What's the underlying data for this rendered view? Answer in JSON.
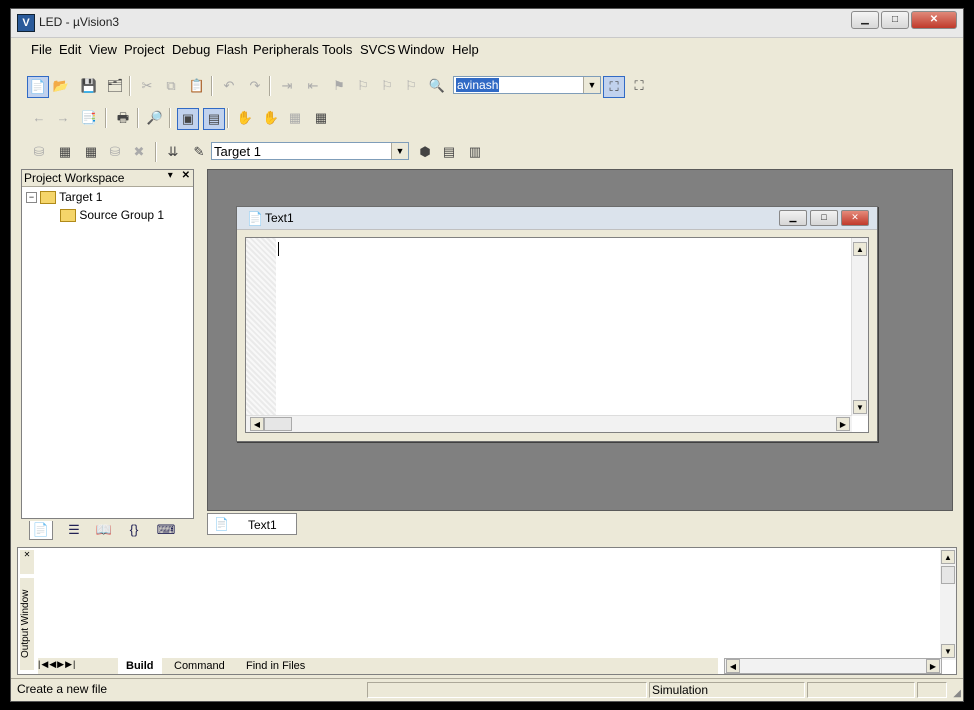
{
  "window": {
    "title": "LED  - µVision3",
    "app_icon": "V",
    "controls": [
      "minimize",
      "maximize",
      "close"
    ]
  },
  "menu": {
    "items": [
      "File",
      "Edit",
      "View",
      "Project",
      "Debug",
      "Flash",
      "Peripherals",
      "Tools",
      "SVCS",
      "Window",
      "Help"
    ]
  },
  "toolbar": {
    "find_text": "avinash",
    "target_select": "Target 1"
  },
  "workspace": {
    "title": "Project Workspace",
    "tree": [
      {
        "label": "Target 1",
        "expanded": true
      },
      {
        "label": "Source Group 1"
      }
    ],
    "tab_icons": [
      "files-tab-icon",
      "registers-tab-icon",
      "books-tab-icon",
      "functions-tab-icon",
      "templates-tab-icon"
    ]
  },
  "document": {
    "title": "Text1"
  },
  "mdi_tabs": [
    "Text1"
  ],
  "output": {
    "label": "Output Window",
    "tabs": [
      "Build",
      "Command",
      "Find in Files"
    ],
    "active_tab": "Build"
  },
  "status": {
    "message": "Create a new file",
    "mode": "Simulation"
  },
  "colors": {
    "selection": "#316ac5",
    "chrome": "#ece9d8",
    "mdi_background": "#808080"
  }
}
